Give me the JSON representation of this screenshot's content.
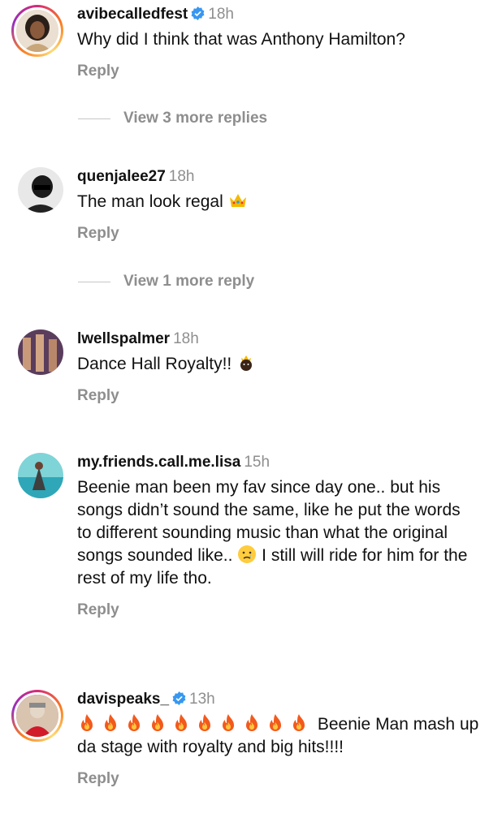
{
  "comments": [
    {
      "username": "avibecalledfest",
      "verified": true,
      "time": "18h",
      "text": "Why did I think that was Anthony Hamilton?",
      "reply_label": "Reply",
      "view_more": "View 3 more replies"
    },
    {
      "username": "quenjalee27",
      "verified": false,
      "time": "18h",
      "text": "The man look regal",
      "emoji": "crown-icon",
      "reply_label": "Reply",
      "view_more": "View 1 more reply"
    },
    {
      "username": "lwellspalmer",
      "verified": false,
      "time": "18h",
      "text": "Dance Hall Royalty!!",
      "emoji": "person-with-crown-icon",
      "reply_label": "Reply"
    },
    {
      "username": "my.friends.call.me.lisa",
      "verified": false,
      "time": "15h",
      "text_before": "Beenie man been my fav since day one.. but his songs didn’t sound the same, like he put the words to different sounding music than what the original songs sounded like..",
      "emoji": "crying-face-icon",
      "text_after": "I still will ride for him for the rest of my life tho.",
      "reply_label": "Reply"
    },
    {
      "username": "davispeaks_",
      "verified": true,
      "time": "13h",
      "fire_count": 10,
      "text": "Beenie Man mash up da stage with royalty and big hits!!!!",
      "reply_label": "Reply"
    }
  ],
  "colors": {
    "secondary_text": "#8e8e8e",
    "verified_blue": "#3797f0"
  }
}
